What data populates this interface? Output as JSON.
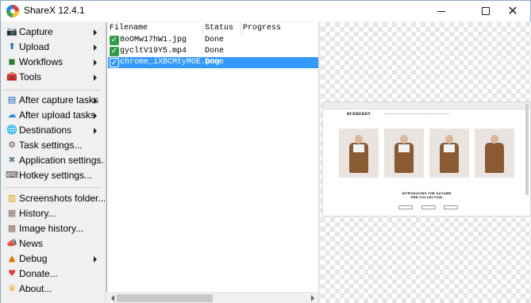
{
  "window": {
    "title": "ShareX 12.4.1",
    "minimize_glyph": "",
    "close_glyph": "✕"
  },
  "menu": {
    "items": [
      {
        "label": "Capture",
        "icon": "camera-icon",
        "glyph": "📷",
        "submenu": true
      },
      {
        "label": "Upload",
        "icon": "upload-arrow-icon",
        "glyph": "⬆",
        "submenu": true
      },
      {
        "label": "Workflows",
        "icon": "workflow-icon",
        "glyph": "◼",
        "submenu": true
      },
      {
        "label": "Tools",
        "icon": "toolbox-icon",
        "glyph": "🧰",
        "submenu": true
      },
      {
        "label": "After capture tasks",
        "icon": "after-capture-icon",
        "glyph": "▤",
        "submenu": true
      },
      {
        "label": "After upload tasks",
        "icon": "after-upload-icon",
        "glyph": "☁",
        "submenu": true
      },
      {
        "label": "Destinations",
        "icon": "globe-icon",
        "glyph": "🌐",
        "submenu": true
      },
      {
        "label": "Task settings...",
        "icon": "gear-icon",
        "glyph": "⚙",
        "submenu": false
      },
      {
        "label": "Application settings...",
        "icon": "wrench-icon",
        "glyph": "✖",
        "submenu": false
      },
      {
        "label": "Hotkey settings...",
        "icon": "keyboard-icon",
        "glyph": "⌨",
        "submenu": false
      },
      {
        "label": "Screenshots folder...",
        "icon": "folder-icon",
        "glyph": "▥",
        "submenu": false
      },
      {
        "label": "History...",
        "icon": "history-icon",
        "glyph": "▦",
        "submenu": false
      },
      {
        "label": "Image history...",
        "icon": "image-history-icon",
        "glyph": "▩",
        "submenu": false
      },
      {
        "label": "News",
        "icon": "megaphone-icon",
        "glyph": "📣",
        "submenu": false
      },
      {
        "label": "Debug",
        "icon": "debug-cone-icon",
        "glyph": "▲",
        "submenu": true
      },
      {
        "label": "Donate...",
        "icon": "heart-icon",
        "glyph": "♥",
        "submenu": false
      },
      {
        "label": "About...",
        "icon": "crown-icon",
        "glyph": "♛",
        "submenu": false
      }
    ]
  },
  "filelist": {
    "columns": [
      "Filename",
      "Status",
      "Progress"
    ],
    "rows": [
      {
        "filename": "8oOMw17hW1.jpg",
        "status": "Done",
        "selected": false
      },
      {
        "filename": "gycltV19Y5.mp4",
        "status": "Done",
        "selected": false
      },
      {
        "filename": "chrome_iXBCMtyMOE.png",
        "status": "Done",
        "selected": true
      }
    ],
    "check_glyph": "✓"
  },
  "preview": {
    "brand": "BURBERRY",
    "headline_1": "INTRODUCING THE AUTUMN",
    "headline_2": "PRE-COLLECTION"
  },
  "colors": {
    "selection": "#3399ff",
    "done_check": "#2f9e44",
    "menu_bg": "#f0f0f0"
  }
}
